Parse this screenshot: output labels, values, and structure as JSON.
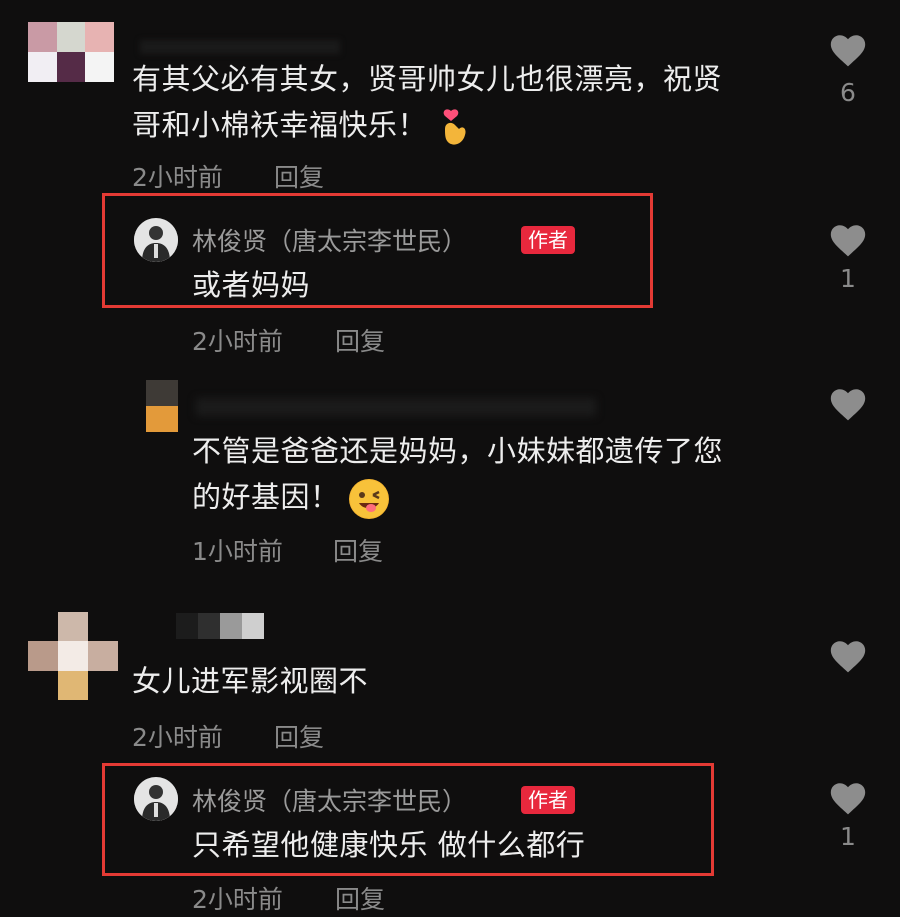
{
  "comments": [
    {
      "text": "有其父必有其女，贤哥帅女儿也很漂亮，祝贤哥和小棉袄幸福快乐！",
      "text_line1": "有其父必有其女，贤哥帅女儿也很漂亮，祝贤",
      "text_line2": "哥和小棉袄幸福快乐！",
      "time": "2小时前",
      "reply_label": "回复",
      "likes": "6"
    },
    {
      "username": "林俊贤（唐太宗李世民）",
      "badge": "作者",
      "text": "或者妈妈",
      "time": "2小时前",
      "reply_label": "回复",
      "likes": "1"
    },
    {
      "text_line1": "不管是爸爸还是妈妈，小妹妹都遗传了您",
      "text_line2": "的好基因！",
      "time": "1小时前",
      "reply_label": "回复"
    },
    {
      "text": "女儿进军影视圈不",
      "time": "2小时前",
      "reply_label": "回复"
    },
    {
      "username": "林俊贤（唐太宗李世民）",
      "badge": "作者",
      "text": "只希望他健康快乐 做什么都行",
      "time": "2小时前",
      "reply_label": "回复",
      "likes": "1"
    }
  ],
  "colors": {
    "background": "#0f0e0e",
    "highlight": "#e33a34",
    "badge": "#e8283d"
  }
}
